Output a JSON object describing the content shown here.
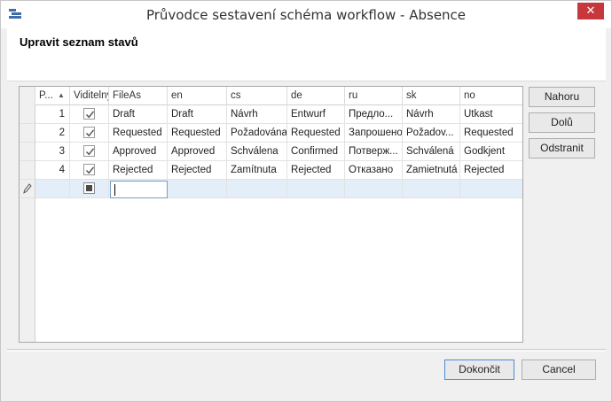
{
  "window": {
    "title": "Průvodce sestavení schéma workflow - Absence",
    "close_glyph": "✕",
    "app_icon": "workflow-app-icon"
  },
  "header": {
    "title": "Upravit seznam stavů"
  },
  "grid": {
    "columns": [
      "P...",
      "Viditelný",
      "FileAs",
      "en",
      "cs",
      "de",
      "ru",
      "sk",
      "no"
    ],
    "sort_indicator": "▲",
    "rows": [
      {
        "order": "1",
        "visible": true,
        "fileas": "Draft",
        "en": "Draft",
        "cs": "Návrh",
        "de": "Entwurf",
        "ru": "Предлo...",
        "sk": "Návrh",
        "no": "Utkast"
      },
      {
        "order": "2",
        "visible": true,
        "fileas": "Requested",
        "en": "Requested",
        "cs": "Požadována",
        "de": "Requested",
        "ru": "Запрошено",
        "sk": "Požadov...",
        "no": "Requested"
      },
      {
        "order": "3",
        "visible": true,
        "fileas": "Approved",
        "en": "Approved",
        "cs": "Schválena",
        "de": "Confirmed",
        "ru": "Потверж...",
        "sk": "Schválená",
        "no": "Godkjent"
      },
      {
        "order": "4",
        "visible": true,
        "fileas": "Rejected",
        "en": "Rejected",
        "cs": "Zamítnuta",
        "de": "Rejected",
        "ru": "Отказано",
        "sk": "Zamietnutá",
        "no": "Rejected"
      }
    ],
    "new_row": {
      "visible_indeterminate": true,
      "editing_value": ""
    }
  },
  "side_buttons": {
    "up": "Nahoru",
    "down": "Dolů",
    "remove": "Odstranit"
  },
  "footer": {
    "finish": "Dokončit",
    "cancel": "Cancel"
  },
  "colors": {
    "close": "#c7383d",
    "accent": "#3f6ea6",
    "new_row": "#e4eef8"
  }
}
